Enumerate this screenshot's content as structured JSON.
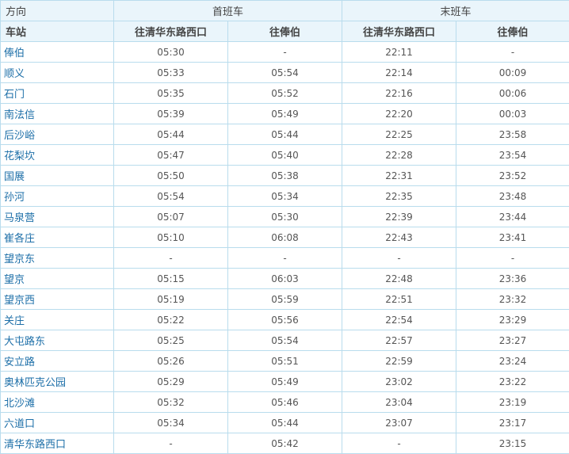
{
  "headers": {
    "direction_label": "方向",
    "first_train": "首班车",
    "last_train": "末班车",
    "station_label": "车站",
    "dir_a": "往清华东路西口",
    "dir_b": "往俸伯"
  },
  "rows": [
    {
      "station": "俸伯",
      "first_a": "05:30",
      "first_b": "-",
      "last_a": "22:11",
      "last_b": "-"
    },
    {
      "station": "顺义",
      "first_a": "05:33",
      "first_b": "05:54",
      "last_a": "22:14",
      "last_b": "00:09"
    },
    {
      "station": "石门",
      "first_a": "05:35",
      "first_b": "05:52",
      "last_a": "22:16",
      "last_b": "00:06"
    },
    {
      "station": "南法信",
      "first_a": "05:39",
      "first_b": "05:49",
      "last_a": "22:20",
      "last_b": "00:03"
    },
    {
      "station": "后沙峪",
      "first_a": "05:44",
      "first_b": "05:44",
      "last_a": "22:25",
      "last_b": "23:58"
    },
    {
      "station": "花梨坎",
      "first_a": "05:47",
      "first_b": "05:40",
      "last_a": "22:28",
      "last_b": "23:54"
    },
    {
      "station": "国展",
      "first_a": "05:50",
      "first_b": "05:38",
      "last_a": "22:31",
      "last_b": "23:52"
    },
    {
      "station": "孙河",
      "first_a": "05:54",
      "first_b": "05:34",
      "last_a": "22:35",
      "last_b": "23:48"
    },
    {
      "station": "马泉营",
      "first_a": "05:07",
      "first_b": "05:30",
      "last_a": "22:39",
      "last_b": "23:44"
    },
    {
      "station": "崔各庄",
      "first_a": "05:10",
      "first_b": "06:08",
      "last_a": "22:43",
      "last_b": "23:41"
    },
    {
      "station": "望京东",
      "first_a": "-",
      "first_b": "-",
      "last_a": "-",
      "last_b": "-"
    },
    {
      "station": "望京",
      "first_a": "05:15",
      "first_b": "06:03",
      "last_a": "22:48",
      "last_b": "23:36"
    },
    {
      "station": "望京西",
      "first_a": "05:19",
      "first_b": "05:59",
      "last_a": "22:51",
      "last_b": "23:32"
    },
    {
      "station": "关庄",
      "first_a": "05:22",
      "first_b": "05:56",
      "last_a": "22:54",
      "last_b": "23:29"
    },
    {
      "station": "大屯路东",
      "first_a": "05:25",
      "first_b": "05:54",
      "last_a": "22:57",
      "last_b": "23:27"
    },
    {
      "station": "安立路",
      "first_a": "05:26",
      "first_b": "05:51",
      "last_a": "22:59",
      "last_b": "23:24"
    },
    {
      "station": "奥林匹克公园",
      "first_a": "05:29",
      "first_b": "05:49",
      "last_a": "23:02",
      "last_b": "23:22"
    },
    {
      "station": "北沙滩",
      "first_a": "05:32",
      "first_b": "05:46",
      "last_a": "23:04",
      "last_b": "23:19"
    },
    {
      "station": "六道口",
      "first_a": "05:34",
      "first_b": "05:44",
      "last_a": "23:07",
      "last_b": "23:17"
    },
    {
      "station": "清华东路西口",
      "first_a": "-",
      "first_b": "05:42",
      "last_a": "-",
      "last_b": "23:15"
    }
  ]
}
